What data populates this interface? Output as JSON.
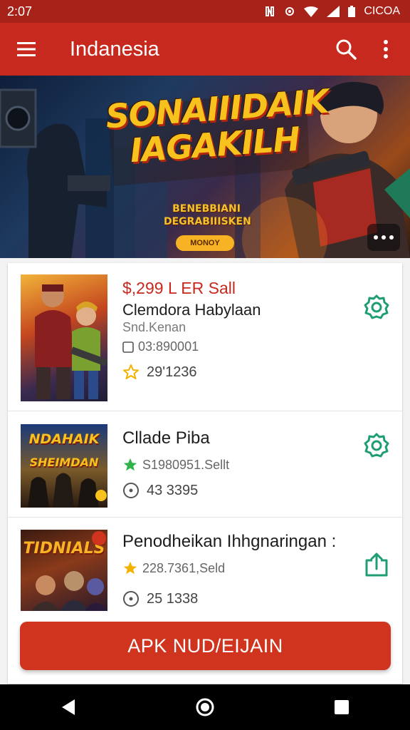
{
  "status_bar": {
    "time": "2:07",
    "right_text": "CICOA"
  },
  "app_bar": {
    "title": "Indanesia"
  },
  "banner": {
    "title_line1": "SONAIIIDAIK",
    "title_line2": "IAGAKILH",
    "subtitle_line1": "BENEBBIANI",
    "subtitle_line2": "DEGRABIIISKEN",
    "button_label": "MONOY"
  },
  "items": [
    {
      "price": "$,299 L ER Sall",
      "title": "Clemdora Habylaan",
      "subtitle": "Snd.Kenan",
      "meta1": "03:890001",
      "meta2": "29'1236",
      "action_icon": "settings-icon"
    },
    {
      "title": "Cllade Piba",
      "rating": "S1980951.Sellt",
      "meta": "43 3395",
      "thumb_text_line1": "NDAHAIK",
      "thumb_text_line2": "SHEIMDAN",
      "action_icon": "settings-icon"
    },
    {
      "title": "Penodheikan Ihhgnaringan :",
      "rating": "228.7361,Seld",
      "meta": "25 1338",
      "thumb_text": "TIDNIALS",
      "action_icon": "share-icon"
    }
  ],
  "cta": {
    "label": "APK NUD/EIJAIN"
  },
  "colors": {
    "primary": "#c8291e",
    "accent_green": "#1f9d75",
    "star_gold": "#f2b300",
    "star_green": "#2fb34a"
  }
}
